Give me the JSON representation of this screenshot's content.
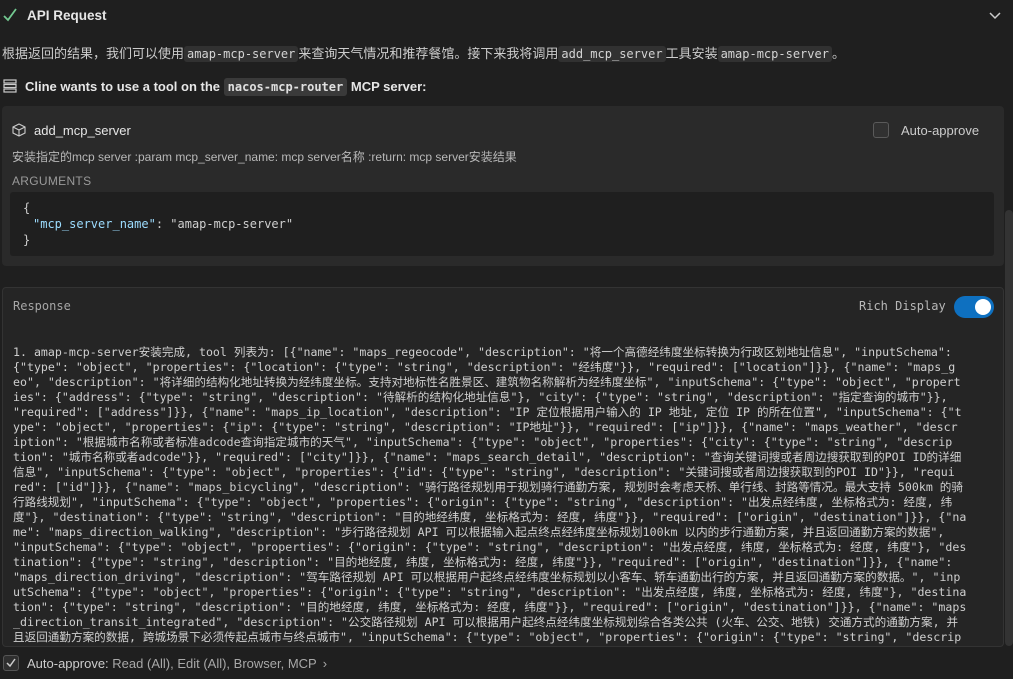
{
  "header": {
    "title": "API Request"
  },
  "intro": {
    "part1": "根据返回的结果，我们可以使用",
    "code1": "amap-mcp-server",
    "part2": "来查询天气情况和推荐餐馆。接下来我将调用",
    "code2": "add_mcp_server",
    "part3": "工具安装",
    "code3": "amap-mcp-server",
    "part4": "。"
  },
  "request": {
    "prefix": "Cline wants to use a tool on the",
    "server": "nacos-mcp-router",
    "suffix": "MCP server:"
  },
  "tool": {
    "name": "add_mcp_server",
    "auto_approve_label": "Auto-approve",
    "description": "安装指定的mcp server :param mcp_server_name: mcp server名称 :return: mcp server安装结果",
    "arguments_label": "ARGUMENTS",
    "args": {
      "open": "{",
      "key": "\"mcp_server_name\"",
      "value": "\"amap-mcp-server\"",
      "close": "}"
    }
  },
  "response": {
    "label": "Response",
    "rich_display_label": "Rich Display",
    "rich_display_on": true,
    "lines": [
      "1. amap-mcp-server安装完成, tool 列表为: [{\"name\": \"maps_regeocode\", \"description\": \"将一个高德经纬度坐标转换为行政区划地址信息\", \"inputSchema\":",
      "{\"type\": \"object\", \"properties\": {\"location\": {\"type\": \"string\", \"description\": \"经纬度\"}}, \"required\": [\"location\"]}}, {\"name\": \"maps_g",
      "eo\", \"description\": \"将详细的结构化地址转换为经纬度坐标。支持对地标性名胜景区、建筑物名称解析为经纬度坐标\", \"inputSchema\": {\"type\": \"object\", \"propert",
      "ies\": {\"address\": {\"type\": \"string\", \"description\": \"待解析的结构化地址信息\"}, \"city\": {\"type\": \"string\", \"description\": \"指定查询的城市\"}},",
      "\"required\": [\"address\"]}}, {\"name\": \"maps_ip_location\", \"description\": \"IP 定位根据用户输入的 IP 地址, 定位 IP 的所在位置\", \"inputSchema\": {\"t",
      "ype\": \"object\", \"properties\": {\"ip\": {\"type\": \"string\", \"description\": \"IP地址\"}}, \"required\": [\"ip\"]}}, {\"name\": \"maps_weather\", \"descr",
      "iption\": \"根据城市名称或者标准adcode查询指定城市的天气\", \"inputSchema\": {\"type\": \"object\", \"properties\": {\"city\": {\"type\": \"string\", \"descrip",
      "tion\": \"城市名称或者adcode\"}}, \"required\": [\"city\"]}}, {\"name\": \"maps_search_detail\", \"description\": \"查询关键词搜或者周边搜获取到的POI ID的详细",
      "信息\", \"inputSchema\": {\"type\": \"object\", \"properties\": {\"id\": {\"type\": \"string\", \"description\": \"关键词搜或者周边搜获取到的POI ID\"}}, \"requi",
      "red\": [\"id\"]}}, {\"name\": \"maps_bicycling\", \"description\": \"骑行路径规划用于规划骑行通勤方案, 规划时会考虑天桥、单行线、封路等情况。最大支持 500km 的骑",
      "行路线规划\", \"inputSchema\": {\"type\": \"object\", \"properties\": {\"origin\": {\"type\": \"string\", \"description\": \"出发点经纬度, 坐标格式为: 经度, 纬",
      "度\"}, \"destination\": {\"type\": \"string\", \"description\": \"目的地经纬度, 坐标格式为: 经度, 纬度\"}}, \"required\": [\"origin\", \"destination\"]}}, {\"na",
      "me\": \"maps_direction_walking\", \"description\": \"步行路径规划 API 可以根据输入起点终点经纬度坐标规划100km 以内的步行通勤方案, 并且返回通勤方案的数据\",",
      "\"inputSchema\": {\"type\": \"object\", \"properties\": {\"origin\": {\"type\": \"string\", \"description\": \"出发点经度, 纬度, 坐标格式为: 经度, 纬度\"}, \"des",
      "tination\": {\"type\": \"string\", \"description\": \"目的地经度, 纬度, 坐标格式为: 经度, 纬度\"}}, \"required\": [\"origin\", \"destination\"]}}, {\"name\":",
      "\"maps_direction_driving\", \"description\": \"驾车路径规划 API 可以根据用户起终点经纬度坐标规划以小客车、轿车通勤出行的方案, 并且返回通勤方案的数据。\", \"inp",
      "utSchema\": {\"type\": \"object\", \"properties\": {\"origin\": {\"type\": \"string\", \"description\": \"出发点经度, 纬度, 坐标格式为: 经度, 纬度\"}, \"destina",
      "tion\": {\"type\": \"string\", \"description\": \"目的地经度, 纬度, 坐标格式为: 经度, 纬度\"}}, \"required\": [\"origin\", \"destination\"]}}, {\"name\": \"maps",
      "_direction_transit_integrated\", \"description\": \"公交路径规划 API 可以根据用户起终点经纬度坐标规划综合各类公共 (火车、公交、地铁) 交通方式的通勤方案, 并",
      "且返回通勤方案的数据, 跨城场景下必须传起点城市与终点城市\", \"inputSchema\": {\"type\": \"object\", \"properties\": {\"origin\": {\"type\": \"string\", \"descrip"
    ]
  },
  "footer": {
    "label": "Auto-approve:",
    "items": "Read (All), Edit (All), Browser, MCP"
  },
  "colors": {
    "accent": "#0e70c0",
    "success": "#73c991",
    "key": "#9cdcfe"
  }
}
